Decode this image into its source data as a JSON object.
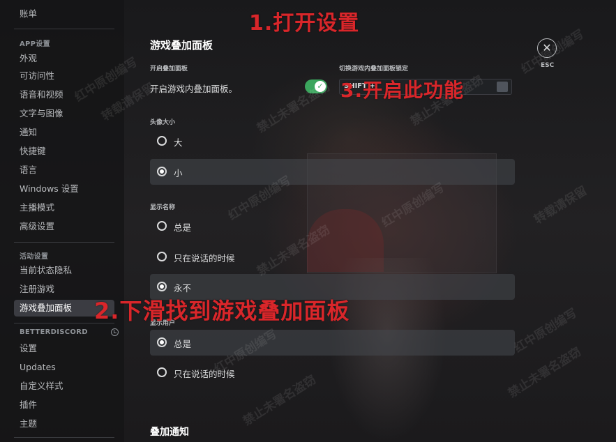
{
  "sidebar": {
    "top_item": "账单",
    "headers": {
      "app_settings": "APP设置",
      "activity_settings": "活动设置",
      "betterdiscord": "BETTERDISCORD"
    },
    "app_items": [
      "外观",
      "可访问性",
      "语音和视频",
      "文字与图像",
      "通知",
      "快捷键",
      "语言",
      "Windows 设置",
      "主播模式",
      "高级设置"
    ],
    "activity_items": [
      "当前状态隐私",
      "注册游戏",
      "游戏叠加面板"
    ],
    "active_item": "游戏叠加面板",
    "bd_items": [
      "设置",
      "Updates",
      "自定义样式",
      "插件",
      "主题"
    ]
  },
  "main": {
    "title": "游戏叠加面板",
    "enable_label": "开启叠加面板",
    "enable_text": "开启游戏内叠加面板。",
    "enable_state": true,
    "lock_label": "切换游戏内叠加面板锁定",
    "lock_key": "SHIFT +",
    "avatar_size": {
      "label": "头像大小",
      "options": [
        "大",
        "小"
      ],
      "selected": "小"
    },
    "display_names": {
      "label": "显示名称",
      "options": [
        "总是",
        "只在说话的时候",
        "永不"
      ],
      "selected": "永不"
    },
    "display_users": {
      "label": "显示用户",
      "options": [
        "总是",
        "只在说话的时候"
      ],
      "selected": "总是"
    },
    "notifications_title": "叠加通知"
  },
  "close": {
    "label": "ESC"
  },
  "annotations": {
    "step1": "1.打开设置",
    "step2": "2.下滑找到游戏叠加面板",
    "step3": "3.开启此功能"
  },
  "watermark": [
    "红中原创编写",
    "转载请保留",
    "禁止未署名盗窃"
  ],
  "colors": {
    "toggle_on": "#3ba55d",
    "annotation": "#d9262a",
    "active_item_bg": "#3b3c42"
  }
}
